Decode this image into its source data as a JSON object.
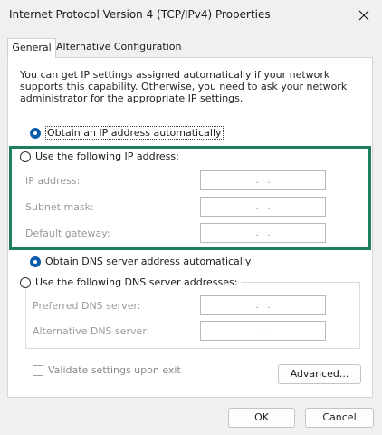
{
  "window": {
    "title": "Internet Protocol Version 4 (TCP/IPv4) Properties"
  },
  "icons": {
    "close": "close-icon"
  },
  "tabs": [
    {
      "label": "General"
    },
    {
      "label": "Alternative Configuration"
    }
  ],
  "general": {
    "description": "You can get IP settings assigned automatically if your network supports this capability. Otherwise, you need to ask your network administrator for the appropriate IP settings.",
    "ip_mode": {
      "auto_label": "Obtain an IP address automatically",
      "manual_label": "Use the following IP address:",
      "selected": "auto"
    },
    "ip_fields": [
      {
        "label": "IP address:",
        "value": ". . ."
      },
      {
        "label": "Subnet mask:",
        "value": ". . ."
      },
      {
        "label": "Default gateway:",
        "value": ". . ."
      }
    ],
    "dns_mode": {
      "auto_label": "Obtain DNS server address automatically",
      "manual_label": "Use the following DNS server addresses:",
      "selected": "auto"
    },
    "dns_fields": [
      {
        "label": "Preferred DNS server:",
        "value": ". . ."
      },
      {
        "label": "Alternative DNS server:",
        "value": ". . ."
      }
    ],
    "validate_label": "Validate settings upon exit",
    "validate_checked": false,
    "advanced_label": "Advanced..."
  },
  "footer": {
    "ok_label": "OK",
    "cancel_label": "Cancel"
  },
  "colors": {
    "accent": "#0b5cad",
    "highlight_border": "#1e7e5c"
  }
}
